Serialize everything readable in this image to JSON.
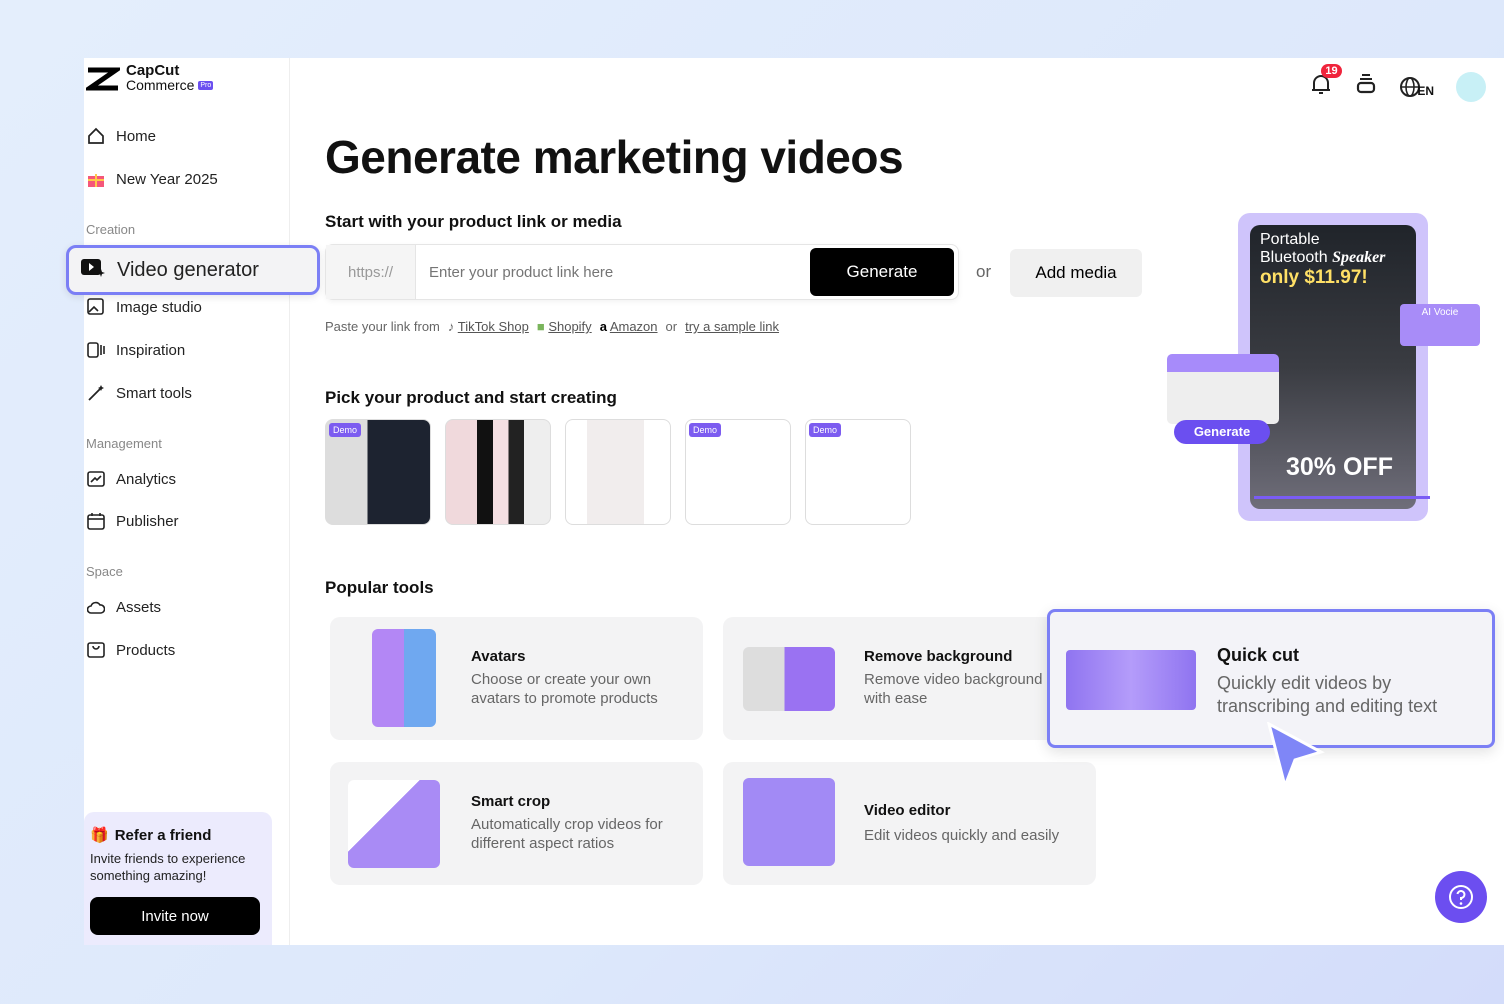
{
  "brand": {
    "name": "CapCut",
    "sub": "Commerce",
    "tag": "Pro"
  },
  "sidebar": {
    "top": [
      {
        "label": "Home"
      },
      {
        "label": "New Year 2025"
      }
    ],
    "creation_title": "Creation",
    "creation": [
      {
        "label": "Video generator",
        "active": true
      },
      {
        "label": "Image studio"
      },
      {
        "label": "Inspiration"
      },
      {
        "label": "Smart tools"
      }
    ],
    "management_title": "Management",
    "management": [
      {
        "label": "Analytics"
      },
      {
        "label": "Publisher"
      }
    ],
    "space_title": "Space",
    "space": [
      {
        "label": "Assets"
      },
      {
        "label": "Products"
      }
    ],
    "refer": {
      "title": "Refer a friend",
      "text": "Invite friends to experience something amazing!",
      "button": "Invite now"
    }
  },
  "topbar": {
    "notifications": "19",
    "language": "EN"
  },
  "main": {
    "title": "Generate marketing videos",
    "start_title": "Start with your product link or media",
    "prefix": "https://",
    "placeholder": "Enter your product link here",
    "generate": "Generate",
    "or": "or",
    "add_media": "Add media",
    "paste": {
      "label": "Paste your link from",
      "tiktok": "TikTok Shop",
      "shopify": "Shopify",
      "amazon": "Amazon",
      "or": "or",
      "sample": "try a sample link"
    },
    "pick_title": "Pick your product and start creating",
    "demo": "Demo",
    "popular_title": "Popular tools",
    "tools": [
      {
        "title": "Avatars",
        "desc": "Choose or create your own avatars to promote products"
      },
      {
        "title": "Remove background",
        "desc": "Remove video background with ease"
      },
      {
        "title": "Quick cut",
        "desc": "Quickly edit videos by transcribing and editing text"
      },
      {
        "title": "Smart crop",
        "desc": "Automatically crop videos for different aspect ratios"
      },
      {
        "title": "Video editor",
        "desc": "Edit videos quickly and easily"
      }
    ]
  },
  "hero": {
    "line1": "Portable",
    "line2": "Bluetooth",
    "line2b": "Speaker",
    "price": "only $11.97!",
    "discount": "30% OFF",
    "ai_voice": "AI Vocie",
    "generate": "Generate"
  },
  "colors": {
    "accent": "#6c4ef0",
    "highlight": "#7b7ff5",
    "badge": "#f0243c"
  }
}
